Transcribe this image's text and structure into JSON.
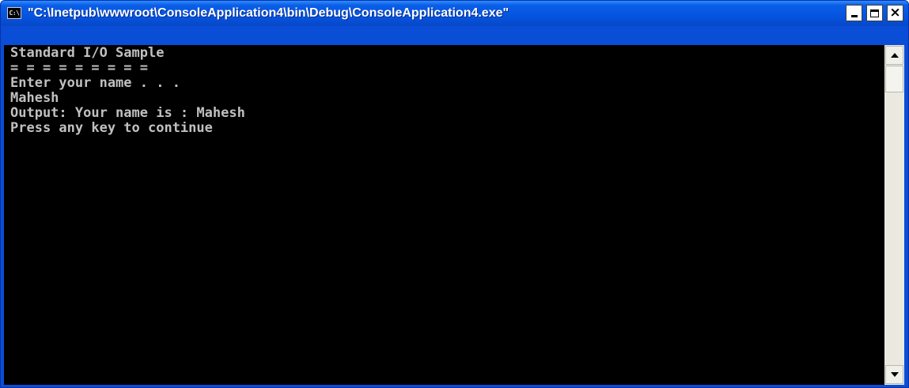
{
  "window": {
    "title": "\"C:\\Inetpub\\wwwroot\\ConsoleApplication4\\bin\\Debug\\ConsoleApplication4.exe\"",
    "icon_label": "C:\\",
    "controls": {
      "minimize_icon": "minimize-icon",
      "maximize_icon": "maximize-icon",
      "close_label": "×"
    }
  },
  "console": {
    "lines": [
      "Standard I/O Sample",
      "= = = = = = = = =",
      "Enter your name . . .",
      "Mahesh",
      "Output: Your name is : Mahesh",
      "Press any key to continue"
    ],
    "text_color": "#c0c0c0",
    "background_color": "#000000"
  },
  "scrollbar": {
    "up_icon": "arrow-up-icon",
    "down_icon": "arrow-down-icon"
  },
  "colors": {
    "titlebar": "#0554e0",
    "title_text": "#ffffff"
  }
}
